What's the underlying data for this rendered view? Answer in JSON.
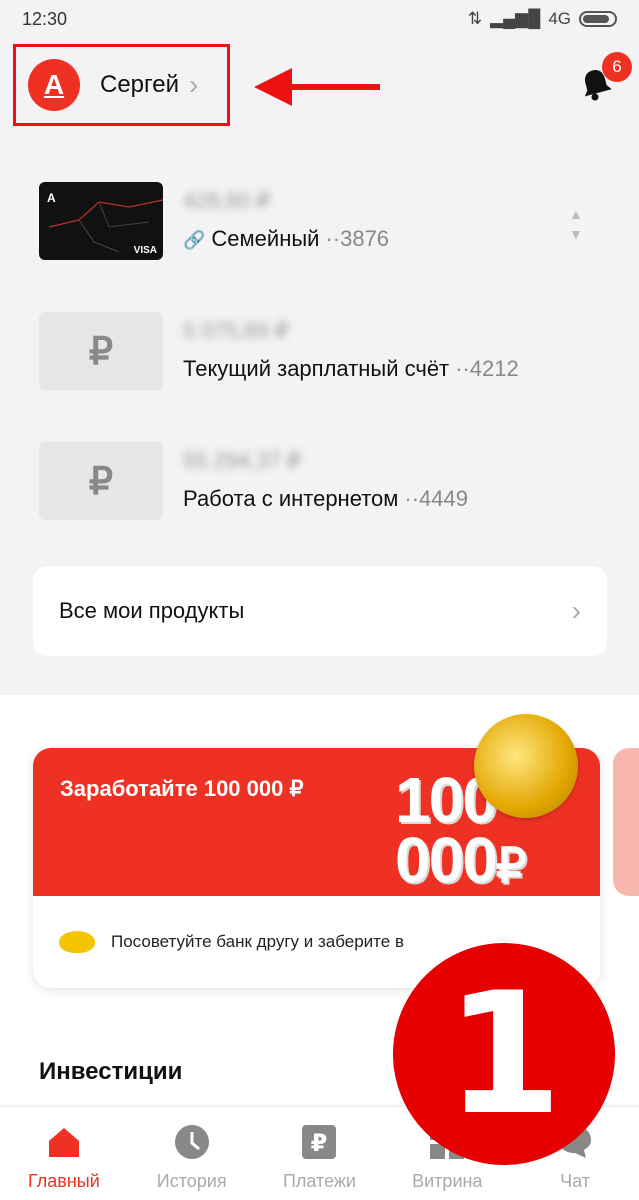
{
  "status": {
    "time": "12:30",
    "network": "4G"
  },
  "profile": {
    "avatar_letter": "А",
    "name": "Сергей"
  },
  "notifications": {
    "count": "6"
  },
  "accounts": [
    {
      "balance": "428,60 ₽",
      "name": "Семейный",
      "number": "··3876",
      "icon": "card-thumbnail",
      "card_brand": "VISA"
    },
    {
      "balance": "5 075,89 ₽",
      "name": "Текущий зарплатный счёт",
      "number": "··4212",
      "icon": "ruble-icon",
      "thumb_symbol": "₽"
    },
    {
      "balance": "55 294,37 ₽",
      "name": "Работа с интернетом",
      "number": "··4449",
      "icon": "ruble-icon",
      "thumb_symbol": "₽"
    }
  ],
  "products": {
    "label": "Все мои продукты"
  },
  "promo": {
    "title": "Заработайте 100 000 ₽",
    "big_line1": "100",
    "big_line2": "000",
    "big_currency": "₽",
    "text": "Посоветуйте банк другу и заберите в"
  },
  "invest": {
    "title": "Инвестиции"
  },
  "nav": [
    {
      "label": "Главный",
      "icon": "home-icon",
      "active": true
    },
    {
      "label": "История",
      "icon": "clock-icon",
      "active": false
    },
    {
      "label": "Платежи",
      "icon": "ruble-square-icon",
      "active": false
    },
    {
      "label": "Витрина",
      "icon": "grid-icon",
      "active": false
    },
    {
      "label": "Чат",
      "icon": "chat-icon",
      "active": false
    }
  ],
  "overlay": {
    "step_number": "1"
  },
  "colors": {
    "brand_red": "#ef3124",
    "annotation_red": "#e11111"
  }
}
